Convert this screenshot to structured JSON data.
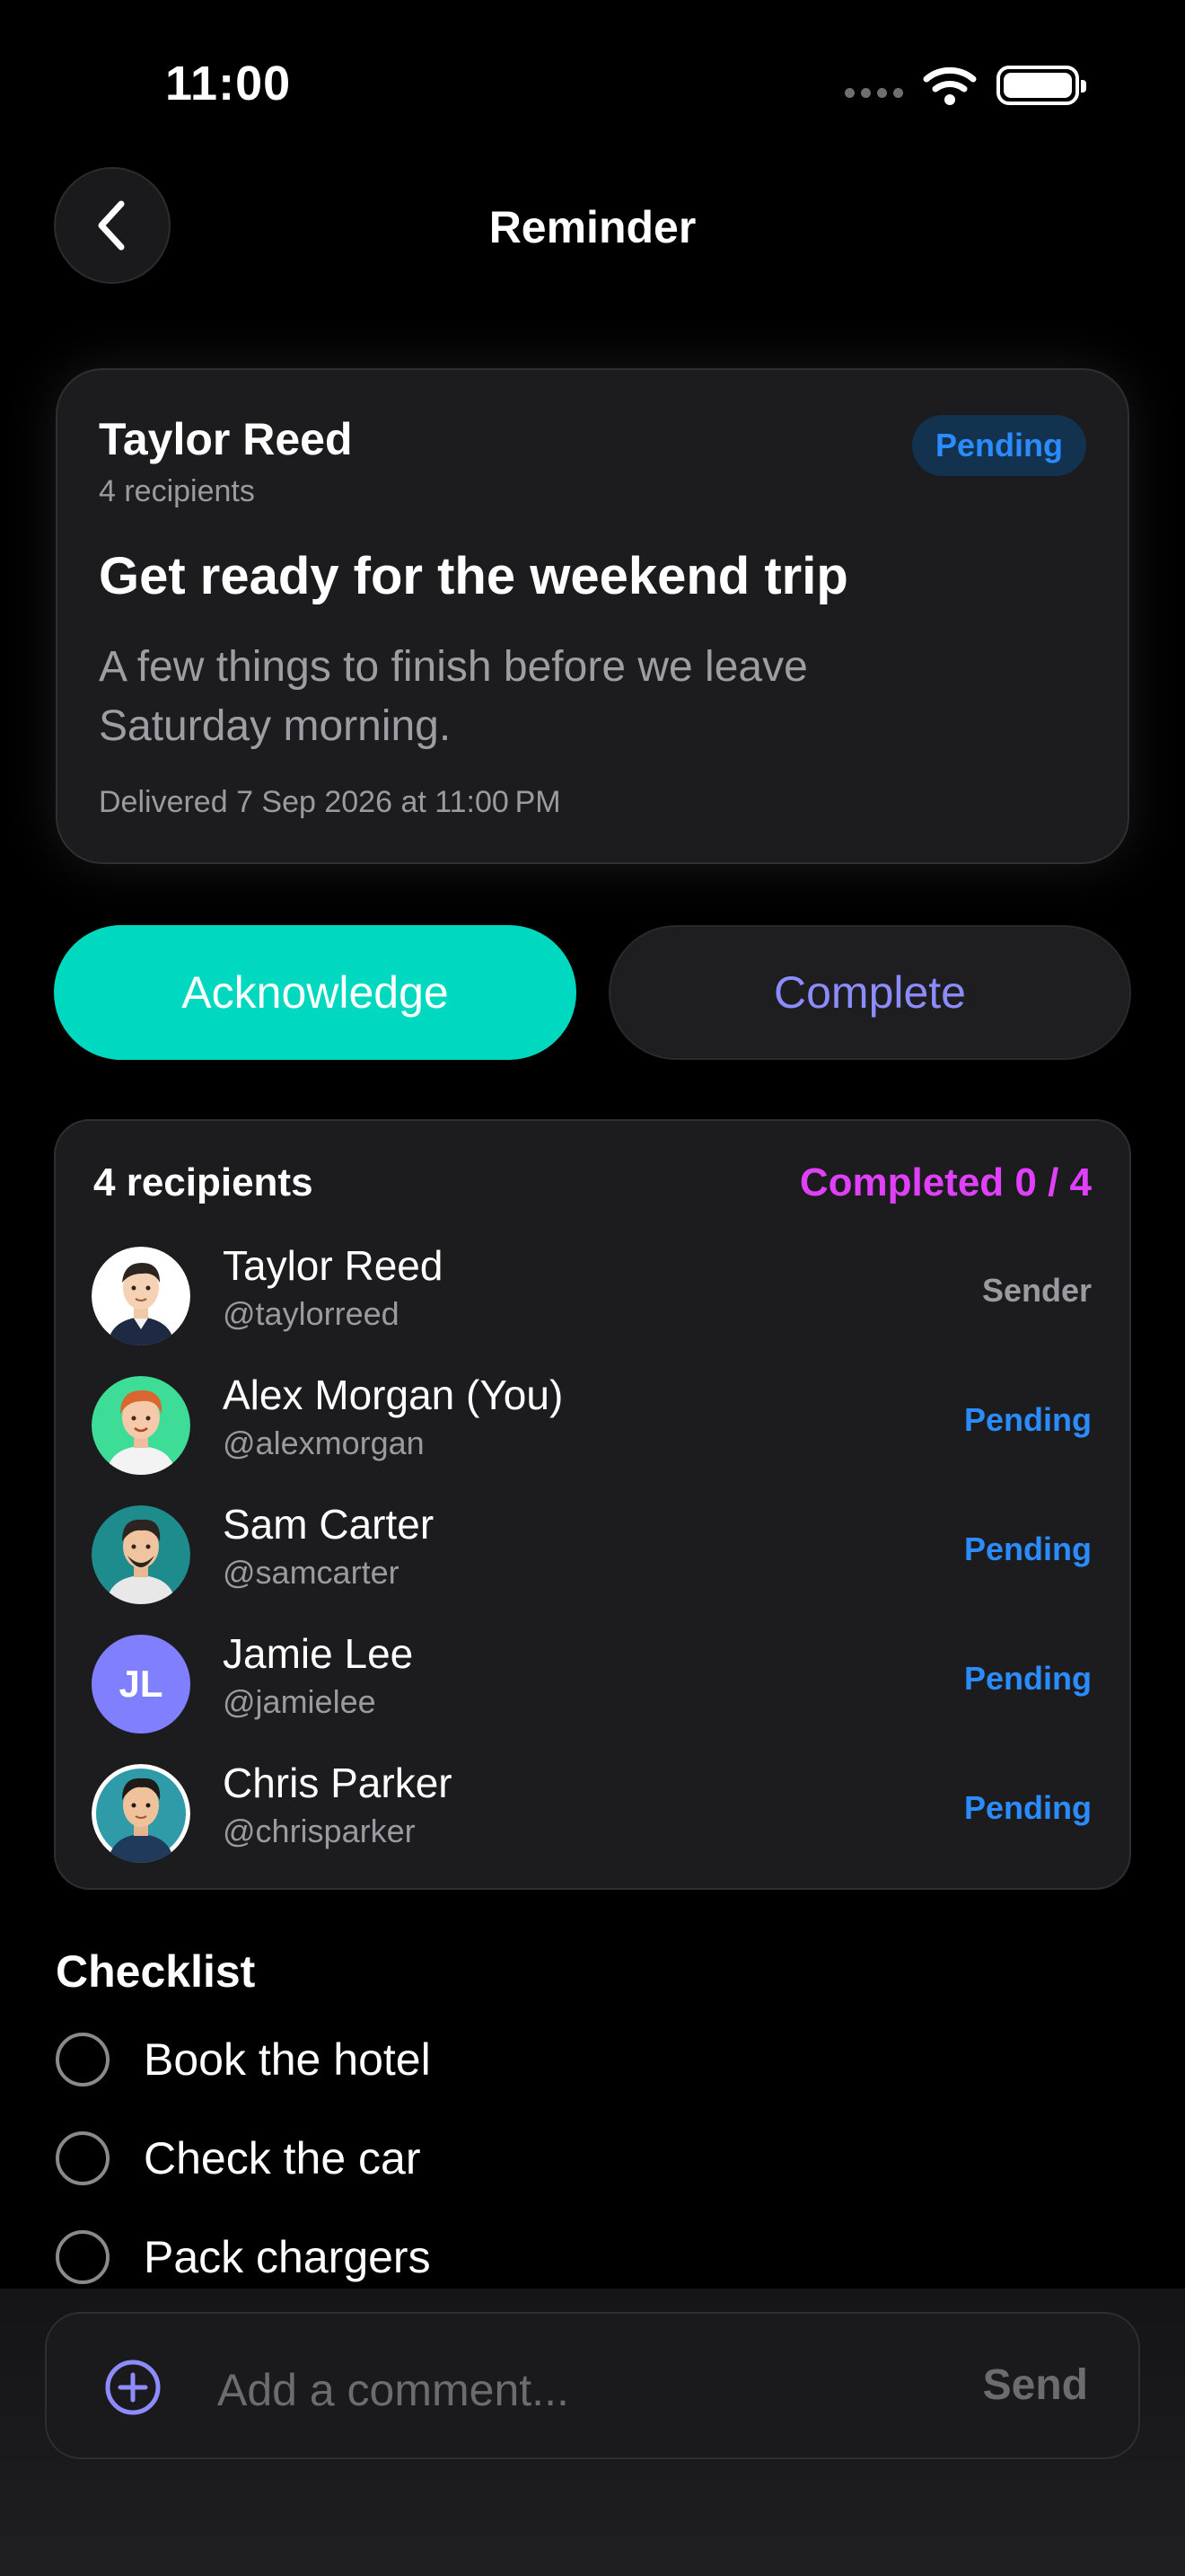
{
  "status_bar": {
    "time": "11:00"
  },
  "nav": {
    "title": "Reminder"
  },
  "reminder": {
    "sender": "Taylor Reed",
    "recipients_label": "4 recipients",
    "status": "Pending",
    "title": "Get ready for the weekend trip",
    "body": "A few things to finish before we leave Saturday morning.",
    "delivered": "Delivered 7 Sep 2026 at 11:00 PM"
  },
  "actions": {
    "acknowledge": "Acknowledge",
    "complete": "Complete"
  },
  "recipients_panel": {
    "title": "4 recipients",
    "progress": "Completed 0 / 4",
    "rows": [
      {
        "name": "Taylor Reed",
        "handle": "@taylorreed",
        "status": "Sender"
      },
      {
        "name": "Alex Morgan (You)",
        "handle": "@alexmorgan",
        "status": "Pending"
      },
      {
        "name": "Sam Carter",
        "handle": "@samcarter",
        "status": "Pending"
      },
      {
        "name": "Jamie Lee",
        "handle": "@jamielee",
        "status": "Pending",
        "initials": "JL"
      },
      {
        "name": "Chris Parker",
        "handle": "@chrisparker",
        "status": "Pending"
      }
    ]
  },
  "checklist": {
    "title": "Checklist",
    "items": [
      "Book the hotel",
      "Check the car",
      "Pack chargers"
    ]
  },
  "composer": {
    "placeholder": "Add a comment...",
    "send": "Send"
  },
  "colors": {
    "accent_teal": "#00d9c0",
    "accent_violet": "#8c8cff",
    "pending_blue": "#2b8cff",
    "progress_magenta": "#e040fb"
  }
}
